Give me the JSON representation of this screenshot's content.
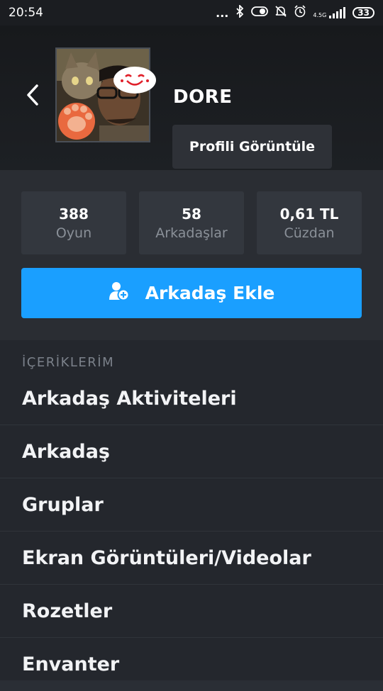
{
  "status_bar": {
    "time": "20:54",
    "dots": "...",
    "network_label": "4.5G",
    "battery": "33"
  },
  "profile": {
    "username": "DORE",
    "view_profile_label": "Profili Görüntüle"
  },
  "stats": [
    {
      "value": "388",
      "label": "Oyun"
    },
    {
      "value": "58",
      "label": "Arkadaşlar"
    },
    {
      "value": "0,61 TL",
      "label": "Cüzdan"
    }
  ],
  "add_friend_label": "Arkadaş Ekle",
  "content": {
    "section_title": "İÇERİKLERİM",
    "items": [
      "Arkadaş Aktiviteleri",
      "Arkadaş",
      "Gruplar",
      "Ekran Görüntüleri/Videolar",
      "Rozetler",
      "Envanter"
    ]
  },
  "colors": {
    "accent": "#1a9fff",
    "header_bg": "#1b1d21",
    "panel_bg": "#33373e",
    "list_bg": "#24272d"
  },
  "icons": [
    "bluetooth-icon",
    "toggle-icon",
    "mute-icon",
    "alarm-icon",
    "signal-icon",
    "battery-icon",
    "back-arrow-icon",
    "add-user-icon"
  ]
}
